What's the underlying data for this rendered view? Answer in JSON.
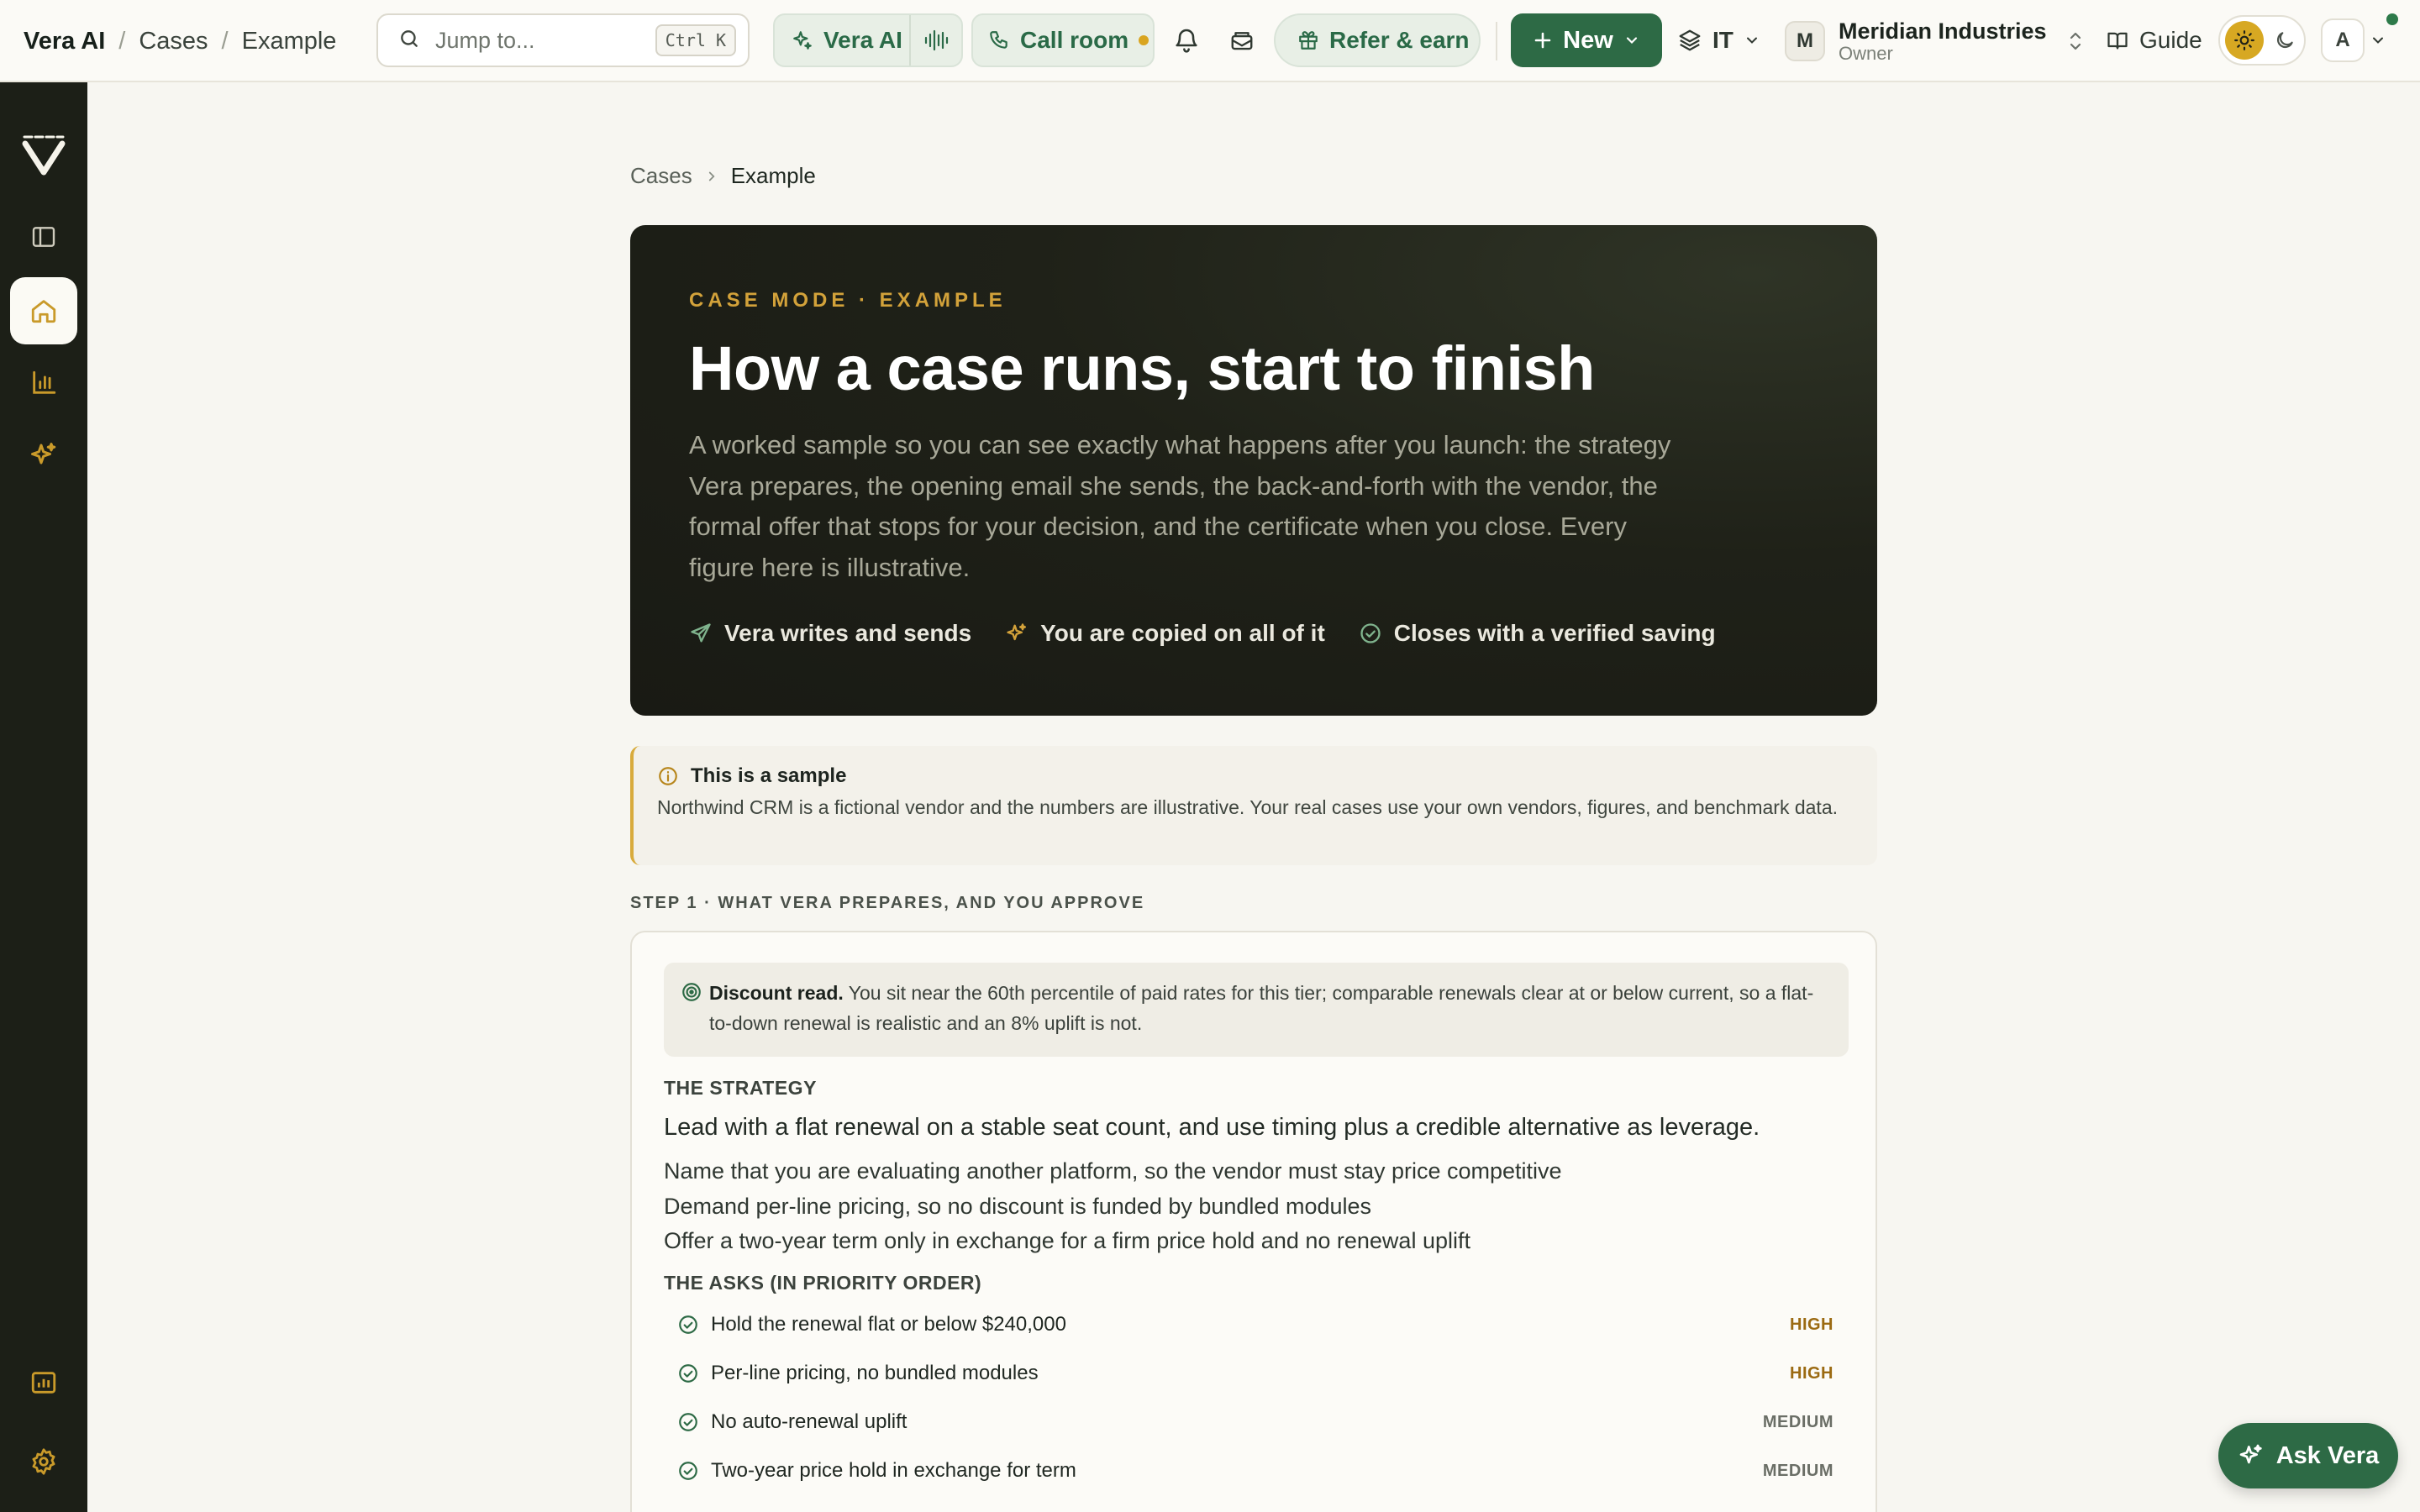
{
  "topbar": {
    "brand": "Vera AI",
    "crumbs": [
      "Cases",
      "Example"
    ],
    "search_placeholder": "Jump to...",
    "search_shortcut": "Ctrl K",
    "vera_label": "Vera AI",
    "call_label": "Call room",
    "refer_label": "Refer & earn",
    "new_label": "New",
    "dept_label": "IT",
    "org_initial": "M",
    "org_name": "Meridian Industries",
    "org_role": "Owner",
    "guide_label": "Guide",
    "user_initial": "A"
  },
  "breadcrumb": {
    "parent": "Cases",
    "current": "Example"
  },
  "hero": {
    "eyebrow": "CASE MODE · EXAMPLE",
    "title": "How a case runs, start to finish",
    "description": "A worked sample so you can see exactly what happens after you launch: the strategy Vera prepares, the opening email she sends, the back-and-forth with the vendor, the formal offer that stops for your decision, and the certificate when you close. Every figure here is illustrative.",
    "features": [
      "Vera writes and sends",
      "You are copied on all of it",
      "Closes with a verified saving"
    ]
  },
  "notice": {
    "title": "This is a sample",
    "body": "Northwind CRM is a fictional vendor and the numbers are illustrative. Your real cases use your own vendors, figures, and benchmark data."
  },
  "step1": {
    "label": "STEP 1 · WHAT VERA PREPARES, AND YOU APPROVE",
    "discount_title": "Discount read.",
    "discount_body": "You sit near the 60th percentile of paid rates for this tier; comparable renewals clear at or below current, so a flat-to-down renewal is realistic and an 8% uplift is not.",
    "strategy_heading": "THE STRATEGY",
    "strategy_lead": "Lead with a flat renewal on a stable seat count, and use timing plus a credible alternative as leverage.",
    "strategy_points": [
      "Name that you are evaluating another platform, so the vendor must stay price competitive",
      "Demand per-line pricing, so no discount is funded by bundled modules",
      "Offer a two-year term only in exchange for a firm price hold and no renewal uplift"
    ],
    "asks_heading": "THE ASKS (IN PRIORITY ORDER)",
    "asks": [
      {
        "label": "Hold the renewal flat or below $240,000",
        "priority": "HIGH"
      },
      {
        "label": "Per-line pricing, no bundled modules",
        "priority": "HIGH"
      },
      {
        "label": "No auto-renewal uplift",
        "priority": "MEDIUM"
      },
      {
        "label": "Two-year price hold in exchange for term",
        "priority": "MEDIUM"
      }
    ]
  },
  "ask_vera_label": "Ask Vera",
  "colors": {
    "accent": "#2d6a45",
    "gold": "#d3a23a",
    "rail": "#1c1f17",
    "hero": "#1f2118"
  }
}
